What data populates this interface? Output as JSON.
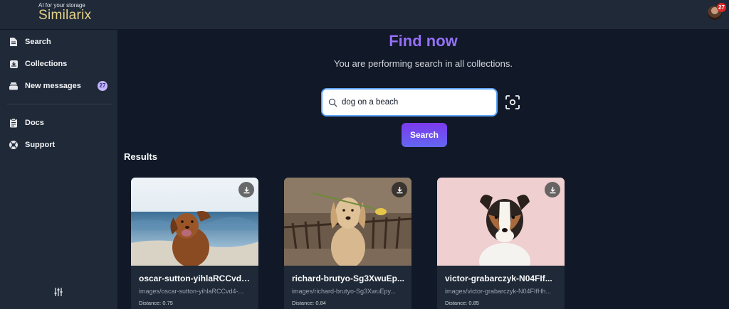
{
  "brand": {
    "tagline": "AI for your storage",
    "name": "Similarix"
  },
  "user": {
    "notification_count": "27"
  },
  "sidebar": {
    "items": [
      {
        "label": "Search",
        "icon": "document-icon"
      },
      {
        "label": "Collections",
        "icon": "inbox-icon"
      },
      {
        "label": "New messages",
        "icon": "mail-stack-icon",
        "badge": "27"
      },
      {
        "label": "Docs",
        "icon": "clipboard-icon"
      },
      {
        "label": "Support",
        "icon": "lifebuoy-icon"
      }
    ],
    "settings_icon": "sliders-icon"
  },
  "main": {
    "title": "Find now",
    "subtitle": "You are performing search in all collections.",
    "search": {
      "value": "dog on a beach",
      "button_label": "Search"
    },
    "results_title": "Results",
    "results": [
      {
        "title": "oscar-sutton-yihlaRCCvd4...",
        "path": "images/oscar-sutton-yihlaRCCvd4-...",
        "distance": "Distance: 0.75"
      },
      {
        "title": "richard-brutyo-Sg3XwuEp...",
        "path": "images/richard-brutyo-Sg3XwuEpy...",
        "distance": "Distance: 0.84"
      },
      {
        "title": "victor-grabarczyk-N04FIf...",
        "path": "images/victor-grabarczyk-N04FIfHh...",
        "distance": "Distance: 0.85"
      }
    ]
  },
  "colors": {
    "background": "#111827",
    "panel": "#1f2937",
    "accent": "#7c3aed",
    "brand": "#e8d28a"
  }
}
